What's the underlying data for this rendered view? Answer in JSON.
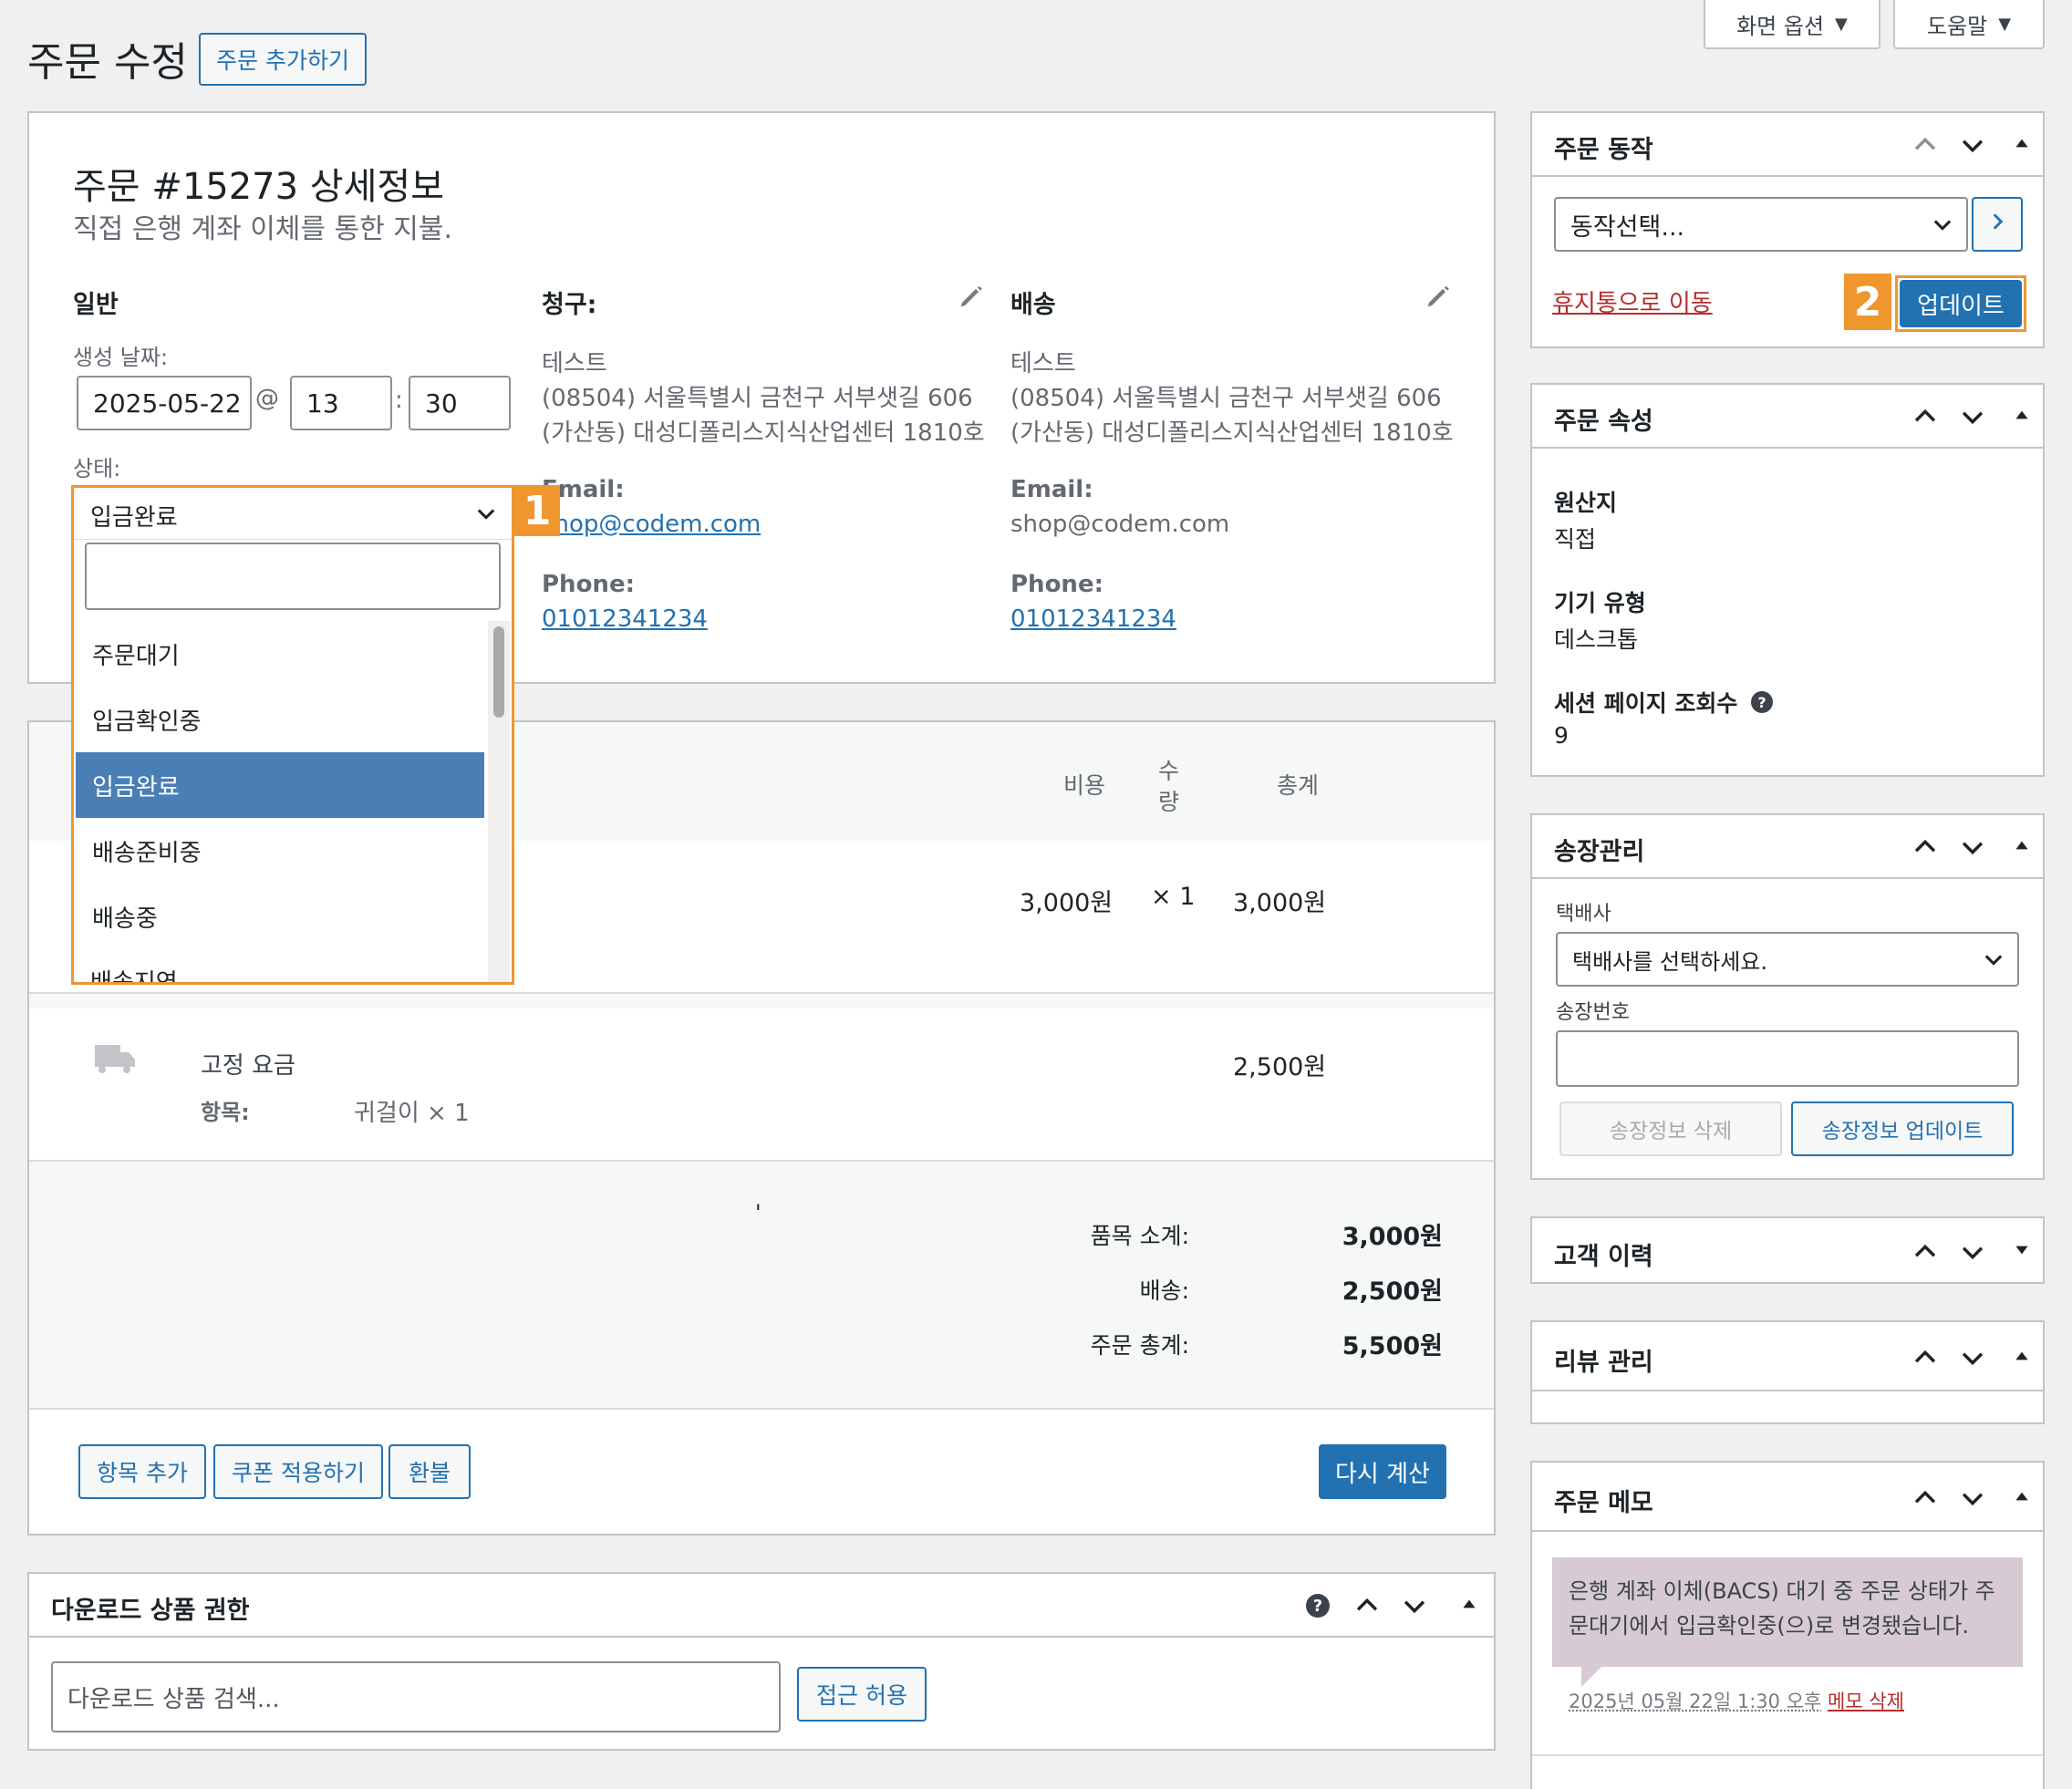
{
  "header": {
    "title": "주문 수정",
    "add_order": "주문 추가하기",
    "screen_options": "화면 옵션",
    "help": "도움말"
  },
  "order": {
    "heading": "주문 #15273 상세정보",
    "payment_desc": "직접 은행 계좌 이체를 통한 지불.",
    "general_label": "일반",
    "created_label": "생성 날짜:",
    "date": "2025-05-22",
    "at": "@",
    "hour": "13",
    "colon": ":",
    "minute": "30",
    "status_label": "상태:",
    "status_value": "입금완료",
    "status_search": "",
    "status_options": [
      "주문대기",
      "입금확인중",
      "입금완료",
      "배송준비중",
      "배송중",
      "배송지연"
    ]
  },
  "billing": {
    "title": "청구:",
    "name": "테스트",
    "addr1": "(08504) 서울특별시 금천구 서부샛길 606",
    "addr2": "(가산동) 대성디폴리스지식산업센터 1810호",
    "email_label": "Email:",
    "email": "shop@codem.com",
    "phone_label": "Phone:",
    "phone": "01012341234"
  },
  "shipping": {
    "title": "배송",
    "name": "테스트",
    "addr1": "(08504) 서울특별시 금천구 서부샛길 606",
    "addr2": "(가산동) 대성디폴리스지식산업센터 1810호",
    "email_label": "Email:",
    "email": "shop@codem.com",
    "phone_label": "Phone:",
    "phone": "01012341234"
  },
  "items": {
    "col_cost": "비용",
    "col_qty_1": "수",
    "col_qty_2": "량",
    "col_total": "총계",
    "row": {
      "cost": "3,000원",
      "qty": "× 1",
      "total": "3,000원"
    },
    "shipping_row": {
      "name": "고정 요금",
      "items_label": "항목:",
      "items_value": "귀걸이 × 1",
      "total": "2,500원"
    },
    "subtotal_label": "품목 소계:",
    "subtotal": "3,000원",
    "shipping_label": "배송:",
    "shipping_total": "2,500원",
    "order_total_label": "주문 총계:",
    "order_total": "5,500원",
    "stray_mark": "'",
    "btn_add_item": "항목 추가",
    "btn_coupon": "쿠폰 적용하기",
    "btn_refund": "환불",
    "btn_recalc": "다시 계산"
  },
  "downloads": {
    "title": "다운로드 상품 권한",
    "search_placeholder": "다운로드 상품 검색...",
    "grant": "접근 허용"
  },
  "actions": {
    "title": "주문 동작",
    "select": "동작선택...",
    "trash": "휴지통으로 이동",
    "update": "업데이트"
  },
  "attributes": {
    "title": "주문 속성",
    "origin_label": "원산지",
    "origin": "직접",
    "device_label": "기기 유형",
    "device": "데스크톱",
    "views_label": "세션 페이지 조회수",
    "views": "9"
  },
  "invoice": {
    "title": "송장관리",
    "courier_label": "택배사",
    "courier_select": "택배사를 선택하세요.",
    "tracking_label": "송장번호",
    "tracking_value": "",
    "delete": "송장정보 삭제",
    "update": "송장정보 업데이트"
  },
  "customer_history": {
    "title": "고객 이력"
  },
  "review": {
    "title": "리뷰 관리"
  },
  "notes": {
    "title": "주문 메모",
    "note_text": "은행 계좌 이체(BACS) 대기 중 주문 상태가 주문대기에서 입금확인중(으)로 변경됐습니다.",
    "note_meta": "2025년 05월 22일 1:30 오후",
    "delete_note": "메모 삭제"
  },
  "callouts": {
    "one": "1",
    "two": "2"
  },
  "colors": {
    "accent": "#2271b1",
    "callout": "#f0962e",
    "trash": "#b32d2e"
  }
}
